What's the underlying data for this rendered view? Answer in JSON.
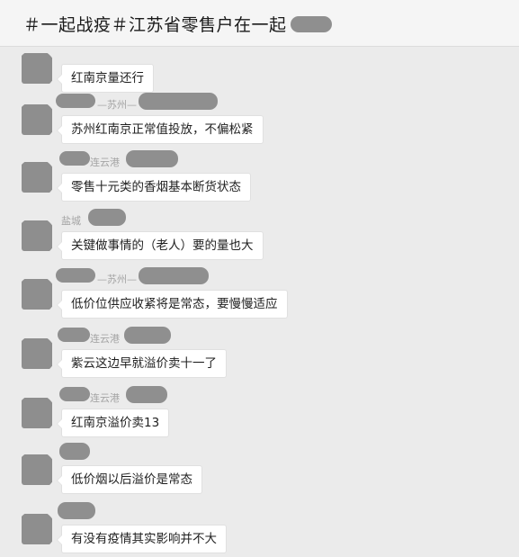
{
  "header": {
    "title": "＃一起战疫＃江苏省零售户在一起"
  },
  "messages": [
    {
      "sender": "",
      "text": "红南京量还行",
      "avatar_color": "#8e8e8e"
    },
    {
      "sender": "—苏州—",
      "text": "苏州红南京正常值投放，不偏松紧",
      "avatar_color": "#8e8e8e"
    },
    {
      "sender": "连云港",
      "text": "零售十元类的香烟基本断货状态",
      "avatar_color": "#8e8e8e"
    },
    {
      "sender": "盐城",
      "text": "关键做事情的（老人）要的量也大",
      "avatar_color": "#8e8e8e"
    },
    {
      "sender": "—苏州—",
      "text": "低价位供应收紧将是常态，要慢慢适应",
      "avatar_color": "#8e8e8e"
    },
    {
      "sender": "连云港",
      "text": "紫云这边早就溢价卖十一了",
      "avatar_color": "#8e8e8e"
    },
    {
      "sender": "连云港",
      "text": "红南京溢价卖13",
      "avatar_color": "#8e8e8e"
    },
    {
      "sender": "",
      "text": "低价烟以后溢价是常态",
      "avatar_color": "#8e8e8e"
    },
    {
      "sender": "",
      "text": "有没有疫情其实影响并不大",
      "avatar_color": "#8e8e8e"
    }
  ]
}
